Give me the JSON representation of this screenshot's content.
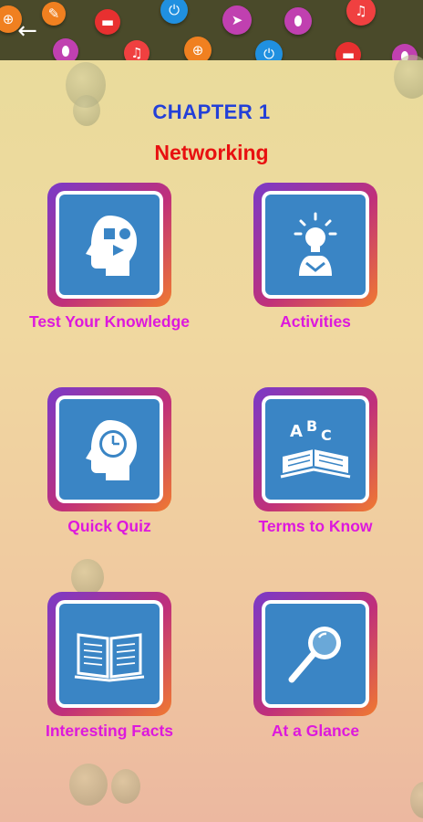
{
  "header": {
    "back_icon": "arrow-left-icon",
    "banner_icons": [
      {
        "name": "add-circle-icon",
        "color": "#f08020",
        "glyph": "⊕"
      },
      {
        "name": "edit-icon",
        "color": "#f08020",
        "glyph": "✎"
      },
      {
        "name": "folder-icon",
        "color": "#e83030",
        "glyph": "▬"
      },
      {
        "name": "power-icon",
        "color": "#2090e0",
        "glyph": "⏻"
      },
      {
        "name": "cursor-icon",
        "color": "#c040b0",
        "glyph": "➤"
      },
      {
        "name": "mouse-icon",
        "color": "#c040b0",
        "glyph": "⬮"
      },
      {
        "name": "headphones-icon",
        "color": "#f04040",
        "glyph": "♫"
      },
      {
        "name": "mouse-icon",
        "color": "#c040b0",
        "glyph": "⬮"
      },
      {
        "name": "headphones-icon",
        "color": "#f04040",
        "glyph": "♫"
      },
      {
        "name": "add-circle-icon",
        "color": "#f08020",
        "glyph": "⊕"
      },
      {
        "name": "power-icon",
        "color": "#2090e0",
        "glyph": "⏻"
      },
      {
        "name": "folder-icon",
        "color": "#e83030",
        "glyph": "▬"
      },
      {
        "name": "mouse-icon",
        "color": "#c040b0",
        "glyph": "⬮"
      }
    ]
  },
  "chapter": {
    "title": "CHAPTER 1",
    "subtitle": "Networking"
  },
  "tiles": [
    {
      "label": "Test Your Knowledge",
      "icon": "head-shapes-icon"
    },
    {
      "label": "Activities",
      "icon": "lightbulb-person-icon"
    },
    {
      "label": "Quick Quiz",
      "icon": "head-clock-icon"
    },
    {
      "label": "Terms to Know",
      "icon": "abc-book-icon"
    },
    {
      "label": "Interesting Facts",
      "icon": "open-book-icon"
    },
    {
      "label": "At a Glance",
      "icon": "magnifier-icon"
    }
  ],
  "colors": {
    "title": "#2340d8",
    "subtitle": "#e81010",
    "tile_label": "#dd18dd",
    "tile_box": "#3a85c5"
  }
}
